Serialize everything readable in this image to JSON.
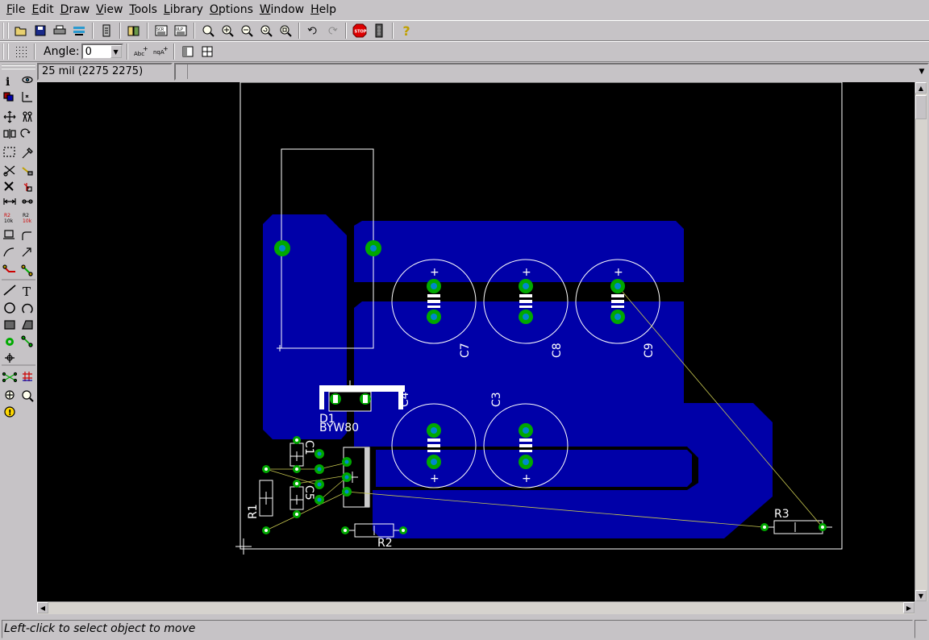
{
  "menu": [
    "File",
    "Edit",
    "Draw",
    "View",
    "Tools",
    "Library",
    "Options",
    "Window",
    "Help"
  ],
  "menu_underline_index": [
    0,
    0,
    0,
    0,
    0,
    0,
    0,
    0,
    0
  ],
  "toolbar2": {
    "angle_label": "Angle:",
    "angle_value": "0"
  },
  "coordinates": "25 mil (2275 2275)",
  "status": "Left-click to select object to move",
  "components": {
    "c7": "C7",
    "c8": "C8",
    "c9": "C9",
    "c4": "C4",
    "c3": "C3",
    "c1": "C1",
    "c5": "C5",
    "d1": "D1",
    "d1_value": "BYW80",
    "r1": "R1",
    "r2": "R2",
    "r3": "R3"
  },
  "colors": {
    "copper": "#0000a8",
    "pad": "#00a800",
    "drill": "#0088cc",
    "outline": "#ffffff",
    "airwire": "#c8c850"
  },
  "toolbar_icons": [
    "open-icon",
    "save-icon",
    "print-icon",
    "cam-icon",
    "export-icon",
    "library-icon",
    "script-icon",
    "run-icon",
    "zoom-fit-icon",
    "zoom-in-icon",
    "zoom-out-icon",
    "zoom-redraw-icon",
    "zoom-select-icon",
    "undo-icon",
    "redo-icon",
    "stop-icon",
    "go-icon",
    "help-icon"
  ],
  "palette_icons": [
    "info-icon",
    "show-icon",
    "display-icon",
    "mark-icon",
    "move-icon",
    "copy-icon",
    "mirror-icon",
    "rotate-icon",
    "group-icon",
    "change-icon",
    "cut-icon",
    "paste-icon",
    "delete-icon",
    "add-icon",
    "pinswap-icon",
    "replace-icon",
    "name-icon",
    "value-icon",
    "smash-icon",
    "miter-icon",
    "split-icon",
    "optimize-icon",
    "route-icon",
    "ripup-icon",
    "wire-icon",
    "text-icon",
    "circle-icon",
    "arc-icon",
    "rect-icon",
    "polygon-icon",
    "via-icon",
    "signal-icon",
    "hole-icon",
    "ratsnest-icon",
    "autorouter-icon",
    "drc-icon",
    "errors-icon",
    "erc-icon"
  ]
}
